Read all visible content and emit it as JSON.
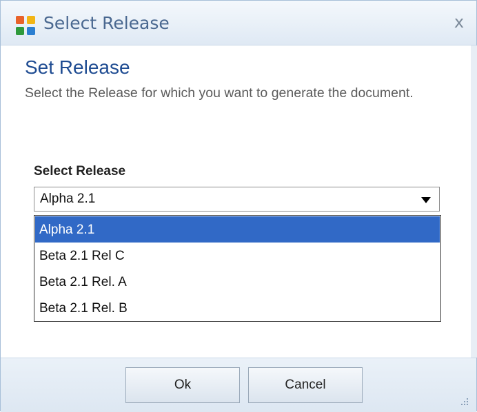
{
  "window": {
    "title": "Select Release",
    "close_glyph": "x"
  },
  "main": {
    "heading": "Set Release",
    "description": "Select the Release for which you want to generate the document."
  },
  "field": {
    "label": "Select Release",
    "value": "Alpha 2.1"
  },
  "dropdown": {
    "options": [
      "Alpha 2.1",
      "Beta 2.1 Rel C",
      "Beta 2.1 Rel. A",
      "Beta 2.1 Rel. B"
    ],
    "selected_index": 0
  },
  "footer": {
    "ok_label": "Ok",
    "cancel_label": "Cancel"
  },
  "colors": {
    "title_text": "#4a6890",
    "heading": "#1f4c92",
    "selection": "#3169c6"
  },
  "icons": {
    "app": "app-logo-icon",
    "close": "close-icon",
    "dropdown": "dropdown-arrow-icon",
    "resize": "resize-grip-icon"
  }
}
